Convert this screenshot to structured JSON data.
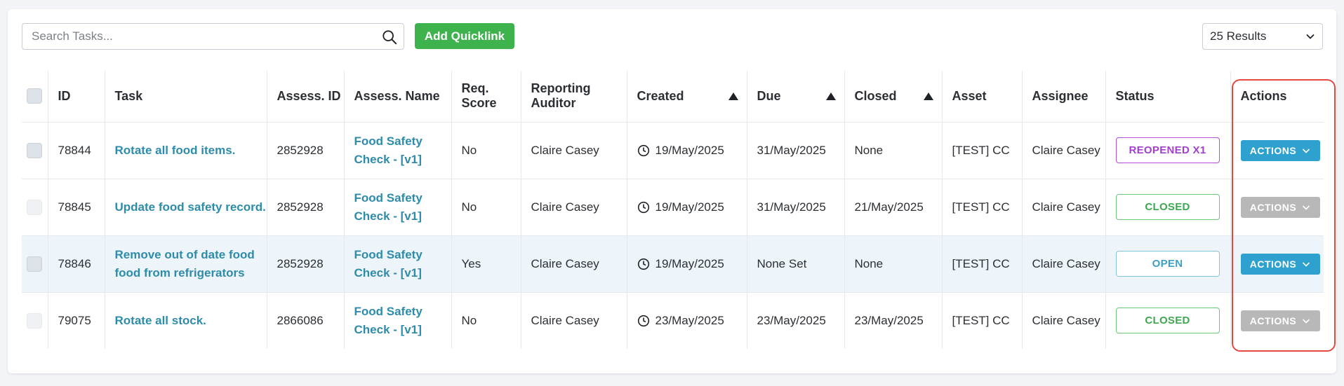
{
  "toolbar": {
    "search_placeholder": "Search Tasks...",
    "search_value": "",
    "quicklink_label": "Add Quicklink",
    "results_label": "25 Results"
  },
  "table": {
    "headers": {
      "id": "ID",
      "task": "Task",
      "assess_id": "Assess. ID",
      "assess_name": "Assess. Name",
      "req_score": "Req. Score",
      "reporting_auditor": "Reporting Auditor",
      "created": "Created",
      "due": "Due",
      "closed": "Closed",
      "asset": "Asset",
      "assignee": "Assignee",
      "status": "Status",
      "actions": "Actions"
    },
    "rows": [
      {
        "id": "78844",
        "task": "Rotate all food items.",
        "assess_id": "2852928",
        "assess_name": "Food Safety Check - [v1]",
        "req_score": "No",
        "auditor": "Claire Casey",
        "created": "19/May/2025",
        "due": "31/May/2025",
        "closed": "None",
        "asset": "[TEST] CC",
        "assignee": "Claire Casey",
        "status": "REOPENED X1",
        "action": "ACTIONS"
      },
      {
        "id": "78845",
        "task": "Update food safety record.",
        "assess_id": "2852928",
        "assess_name": "Food Safety Check - [v1]",
        "req_score": "No",
        "auditor": "Claire Casey",
        "created": "19/May/2025",
        "due": "31/May/2025",
        "closed": "21/May/2025",
        "asset": "[TEST] CC",
        "assignee": "Claire Casey",
        "status": "CLOSED",
        "action": "ACTIONS"
      },
      {
        "id": "78846",
        "task": "Remove out of date food food from refrigerators",
        "assess_id": "2852928",
        "assess_name": "Food Safety Check - [v1]",
        "req_score": "Yes",
        "auditor": "Claire Casey",
        "created": "19/May/2025",
        "due": "None Set",
        "closed": "None",
        "asset": "[TEST] CC",
        "assignee": "Claire Casey",
        "status": "OPEN",
        "action": "ACTIONS"
      },
      {
        "id": "79075",
        "task": "Rotate all stock.",
        "assess_id": "2866086",
        "assess_name": "Food Safety Check - [v1]",
        "req_score": "No",
        "auditor": "Claire Casey",
        "created": "23/May/2025",
        "due": "23/May/2025",
        "closed": "23/May/2025",
        "asset": "[TEST] CC",
        "assignee": "Claire Casey",
        "status": "CLOSED",
        "action": "ACTIONS"
      }
    ]
  },
  "colors": {
    "primary_green": "#3db24d",
    "link_blue": "#2e8cab",
    "action_blue": "#2ea1cf",
    "action_disabled": "#b8b8b8",
    "highlight_red": "#e5483e",
    "reopened_purple": "#a23fcf",
    "closed_green": "#3ea851",
    "open_blue": "#3d9fc4"
  }
}
